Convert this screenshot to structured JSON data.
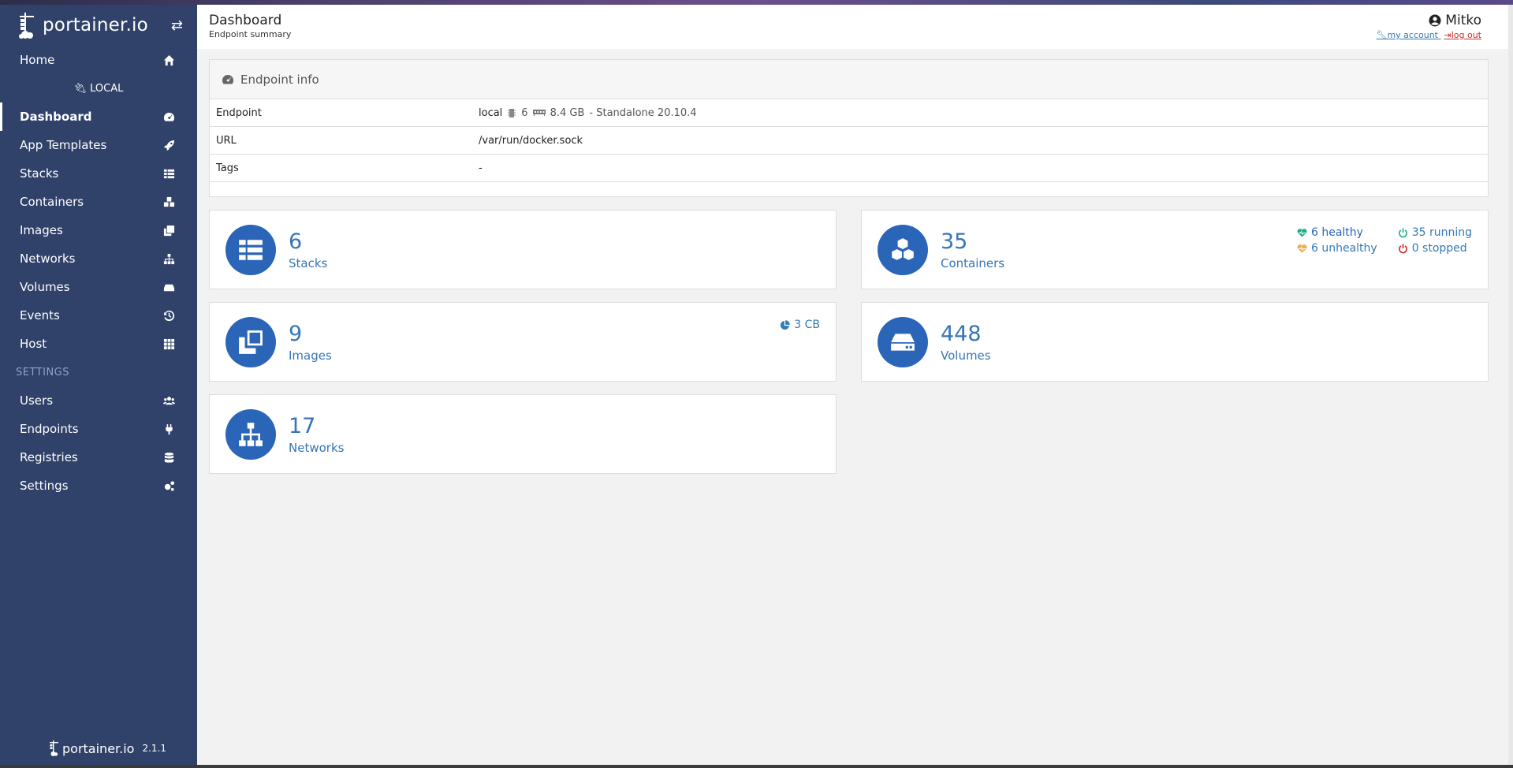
{
  "brand": {
    "name": "portainer.io",
    "version": "2.1.1"
  },
  "nav": {
    "home": "Home",
    "endpoint_name": "LOCAL",
    "items": [
      {
        "label": "Dashboard",
        "icon": "tachometer-icon",
        "active": true
      },
      {
        "label": "App Templates",
        "icon": "rocket-icon"
      },
      {
        "label": "Stacks",
        "icon": "th-list-icon"
      },
      {
        "label": "Containers",
        "icon": "cubes-icon"
      },
      {
        "label": "Images",
        "icon": "clone-icon"
      },
      {
        "label": "Networks",
        "icon": "sitemap-icon"
      },
      {
        "label": "Volumes",
        "icon": "hdd-icon"
      },
      {
        "label": "Events",
        "icon": "history-icon"
      },
      {
        "label": "Host",
        "icon": "th-icon"
      }
    ],
    "settings_header": "SETTINGS",
    "settings_items": [
      {
        "label": "Users",
        "icon": "users-icon"
      },
      {
        "label": "Endpoints",
        "icon": "plug-icon"
      },
      {
        "label": "Registries",
        "icon": "database-icon"
      },
      {
        "label": "Settings",
        "icon": "cogs-icon"
      }
    ]
  },
  "header": {
    "title": "Dashboard",
    "subtitle": "Endpoint summary",
    "user": "Mitko",
    "my_account": "my account",
    "log_out": "log out"
  },
  "endpoint_info": {
    "title": "Endpoint info",
    "rows": {
      "endpoint_key": "Endpoint",
      "endpoint_name": "local",
      "cpu": "6",
      "memory": "8.4 GB",
      "mode": "- Standalone 20.10.4",
      "url_key": "URL",
      "url_val": "/var/run/docker.sock",
      "tags_key": "Tags",
      "tags_val": "-"
    }
  },
  "cards": {
    "stacks": {
      "value": "6",
      "label": "Stacks"
    },
    "containers": {
      "value": "35",
      "label": "Containers",
      "healthy": "6 healthy",
      "running": "35 running",
      "unhealthy": "6 unhealthy",
      "stopped": "0 stopped"
    },
    "images": {
      "value": "9",
      "label": "Images",
      "size": "3 CB"
    },
    "volumes": {
      "value": "448",
      "label": "Volumes"
    },
    "networks": {
      "value": "17",
      "label": "Networks"
    }
  },
  "colors": {
    "sidebar": "#30426a",
    "accent": "#2a65b8",
    "healthy": "#23ae89",
    "unhealthy": "#f0ad4e",
    "stopped": "#c9302c"
  }
}
